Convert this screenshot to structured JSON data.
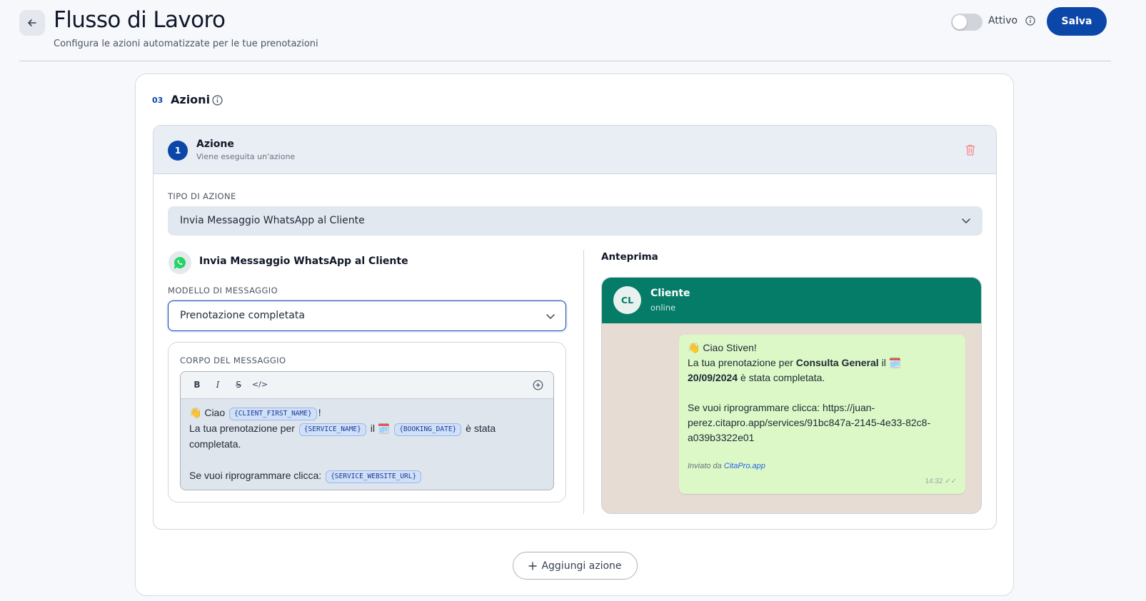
{
  "header": {
    "title": "Flusso di Lavoro",
    "subtitle": "Configura le azioni automatizzate per le tue prenotazioni",
    "toggle_label": "Attivo",
    "save_label": "Salva"
  },
  "section": {
    "number": "03",
    "title": "Azioni"
  },
  "action": {
    "step": "1",
    "title": "Azione",
    "subtitle": "Viene eseguita un'azione",
    "type_label": "TIPO DI AZIONE",
    "type_value": "Invia Messaggio WhatsApp al Cliente",
    "channel_title": "Invia Messaggio WhatsApp al Cliente",
    "template_label": "MODELLO DI MESSAGGIO",
    "template_value": "Prenotazione completata",
    "body_label": "CORPO DEL MESSAGGIO",
    "toolbar": {
      "bold": "B",
      "italic": "I",
      "strike": "S",
      "code": "</>"
    },
    "body": {
      "wave_emoji": "👋",
      "greet": "Ciao",
      "tag_first_name": "{CLIENT_FIRST_NAME}",
      "exclaim": "!",
      "line2_prefix": "La tua prenotazione per",
      "tag_service": "{SERVICE_NAME}",
      "il": "il",
      "calendar_emoji": "🗓️",
      "tag_date": "{BOOKING_DATE}",
      "stata": "è stata",
      "completata": "completata.",
      "reschedule": "Se vuoi riprogrammare clicca:",
      "tag_url": "{SERVICE_WEBSITE_URL}"
    }
  },
  "preview": {
    "label": "Anteprima",
    "avatar_initials": "CL",
    "contact_name": "Cliente",
    "contact_status": "online",
    "wave_emoji": "👋",
    "greeting": "Ciao Stiven!",
    "line2_prefix": "La tua prenotazione per",
    "service": "Consulta General",
    "il": "il",
    "calendar_emoji": "🗓️",
    "date": "20/09/2024",
    "completed": "è stata completata.",
    "reschedule": "Se vuoi riprogrammare clicca: https://juan-perez.citapro.app/services/91bc847a-2145-4e33-82c8-a039b3322e01",
    "sent_by": "Inviato da",
    "sent_link": "CitaPro.app",
    "time": "14:32 ✓✓"
  },
  "add_action": {
    "icon": "plus-icon",
    "label": "Aggiungi azione"
  },
  "colors": {
    "primary": "#0b47a8",
    "whatsapp_header": "#047c68",
    "whatsapp_bubble": "#dcf8c6",
    "chat_background": "#e6dcd3",
    "delete": "#f28b8b"
  }
}
